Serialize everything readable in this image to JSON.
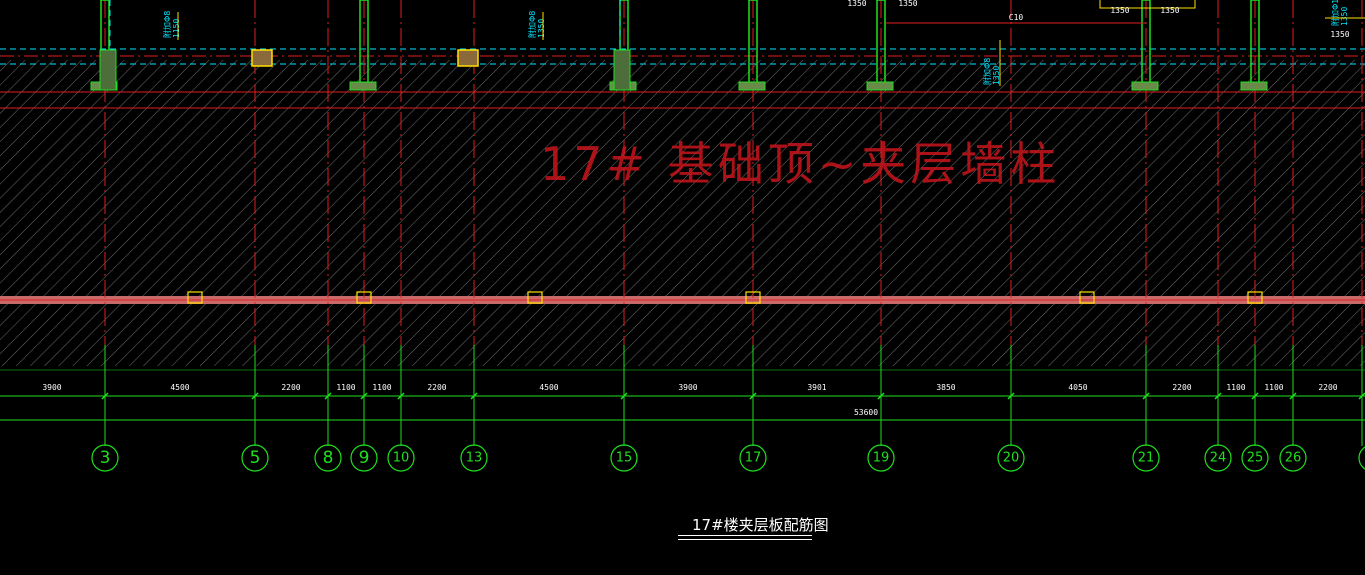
{
  "drawing": {
    "overlay_text": "17# 基础顶~夹层墙柱",
    "title": "17#楼夹层板配筋图"
  },
  "axes": [
    {
      "label": "3"
    },
    {
      "label": "5"
    },
    {
      "label": "8"
    },
    {
      "label": "9"
    },
    {
      "label": "10"
    },
    {
      "label": "13"
    },
    {
      "label": "15"
    },
    {
      "label": "17"
    },
    {
      "label": "19"
    },
    {
      "label": "20"
    },
    {
      "label": "21"
    },
    {
      "label": "24"
    },
    {
      "label": "25"
    },
    {
      "label": "26"
    },
    {
      "label": "2"
    }
  ],
  "dimensions": {
    "segments": [
      "3900",
      "4500",
      "2200",
      "1100",
      "1100",
      "2200",
      "4500",
      "3900",
      "3901",
      "3850",
      "4050",
      "2200",
      "1100",
      "1100",
      "2200"
    ],
    "total": "53600"
  },
  "annotations": [
    {
      "text": "附加Φ8",
      "sub": "1150"
    },
    {
      "text": "附加Φ8",
      "sub": "1350"
    },
    {
      "text": "附加Φ8",
      "sub": "1350"
    },
    {
      "text": "附加Φ10",
      "sub": "1350"
    }
  ],
  "top_dims": [
    "1350",
    "1350",
    "1350",
    "1350",
    "1350"
  ],
  "rebar_label": "C10",
  "colors": {
    "background": "#000000",
    "axis_red": "#e01e1e",
    "grid_green": "#1fe01f",
    "hatch": "#7a7a7a",
    "cyan": "#00e5ff",
    "yellow": "#ffe000",
    "slab_band": "#c86a6a",
    "text_white": "#ffffff"
  }
}
